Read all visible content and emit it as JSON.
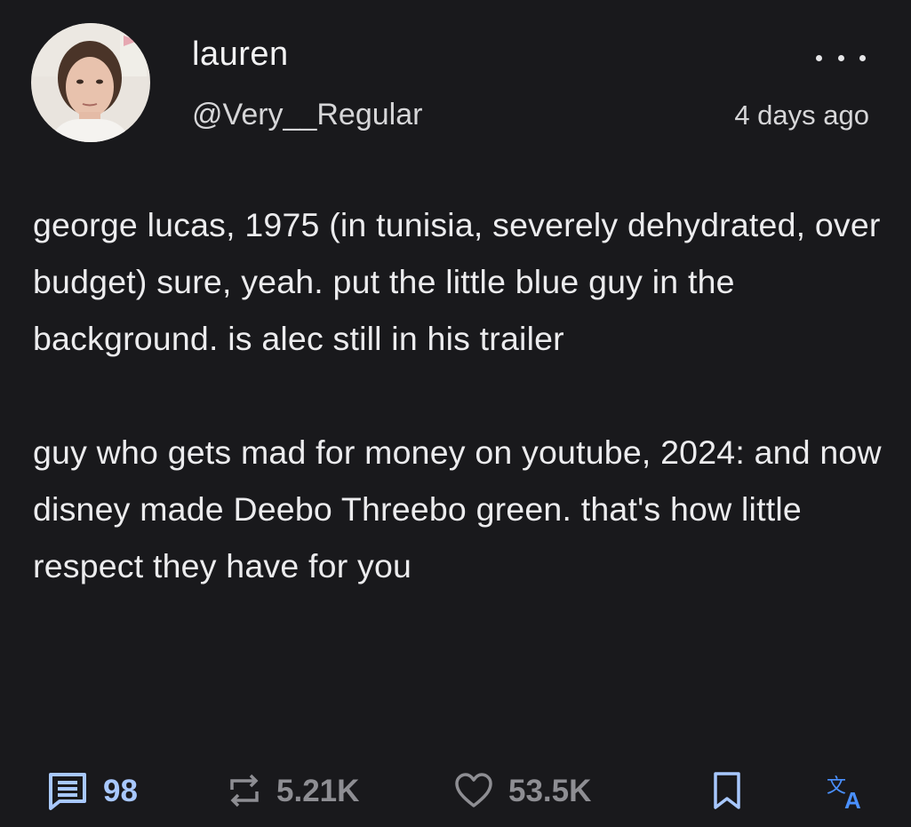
{
  "author": {
    "display_name": "lauren",
    "handle": "@Very__Regular",
    "avatar_icon": "profile-photo"
  },
  "post": {
    "timestamp": "4 days ago",
    "paragraphs": [
      "george lucas, 1975 (in tunisia, severely dehydrated, over budget) sure, yeah. put the little blue guy in the background. is alec still in his trailer",
      "guy who gets mad for money on youtube, 2024: and now disney made Deebo Threebo green. that's how little respect they have for you"
    ]
  },
  "actions": {
    "replies": "98",
    "reposts": "5.21K",
    "likes": "53.5K"
  },
  "icons": {
    "reply": "comment-icon",
    "repost": "repost-icon",
    "like": "heart-icon",
    "bookmark": "bookmark-icon",
    "translate": "translate-icon",
    "more": "more-options-icon"
  },
  "colors": {
    "background": "#19191c",
    "accent": "#a8c8ff",
    "muted": "#8e8e93",
    "translate": "#4a90ff"
  }
}
